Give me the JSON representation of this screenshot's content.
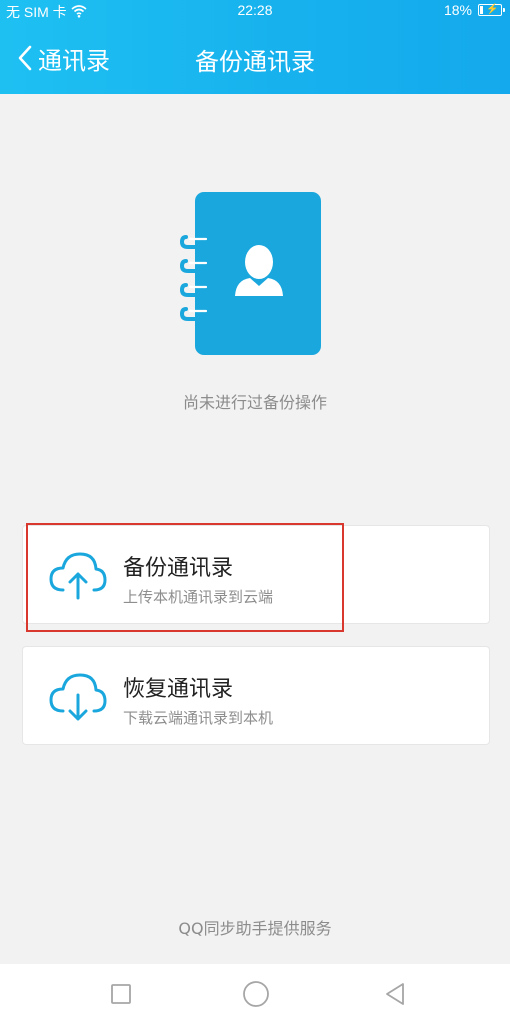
{
  "status_bar": {
    "carrier": "无 SIM 卡",
    "time": "22:28",
    "battery": "18%",
    "battery_level": 0.18,
    "wifi_icon": "wifi-icon",
    "battery_icon": "battery-charging-icon"
  },
  "nav": {
    "back_label": "通讯录",
    "title": "备份通讯录",
    "back_icon": "chevron-left-icon"
  },
  "main": {
    "illustration_icon": "contact-book-icon",
    "empty_text": "尚未进行过备份操作"
  },
  "actions": [
    {
      "title": "备份通讯录",
      "subtitle": "上传本机通讯录到云端",
      "icon": "cloud-upload-icon"
    },
    {
      "title": "恢复通讯录",
      "subtitle": "下载云端通讯录到本机",
      "icon": "cloud-download-icon"
    }
  ],
  "footer": {
    "text": "QQ同步助手提供服务"
  },
  "system_nav": {
    "recents_icon": "square-icon",
    "home_icon": "circle-icon",
    "back_icon": "triangle-back-icon"
  },
  "colors": {
    "header": "#17b2ee",
    "accent": "#1aa7dd",
    "highlight": "#d9382f",
    "background": "#f2f2f2"
  }
}
